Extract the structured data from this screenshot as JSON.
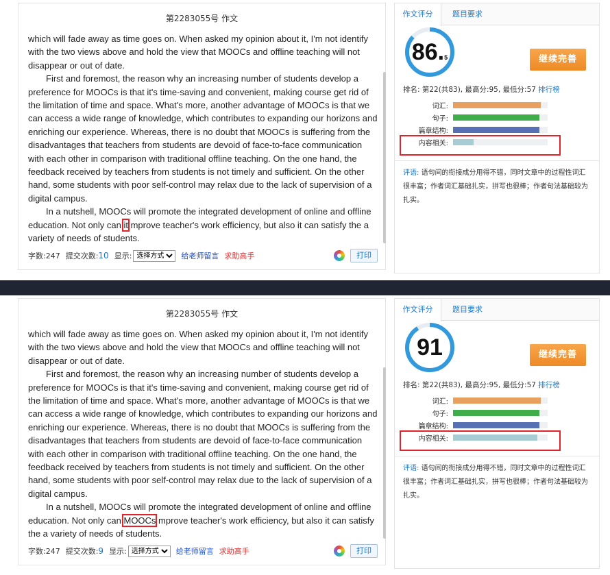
{
  "panels": [
    {
      "essay": {
        "title": "第2283055号 作文",
        "paragraphs": [
          {
            "indent": false,
            "text": "which will fade away as time goes on. When asked my opinion about it, I'm not identify with the two views above and hold the view that MOOCs and offline teaching will not disappear or out of date."
          },
          {
            "indent": true,
            "text": "First and foremost, the reason why an increasing number of students develop a preference for MOOCs is that it's time-saving and convenient, making course get rid of the limitation of time and space. What's more, another advantage of MOOCs is that we can access a wide range of knowledge, which contributes to expanding our horizons and enriching our experience. Whereas, there is no doubt that MOOCs is suffering from the disadvantages that teachers from students are devoid of face-to-face communication with each other in comparison with traditional offline teaching. On the one hand, the feedback received by teachers from students is not timely and sufficient. On the other hand, some students with poor self-control may relax due to the lack of supervision of a digital campus."
          },
          {
            "indent": true,
            "before": "In a nutshell, MOOCs will promote the integrated development of online and offline education. Not only can ",
            "highlight": "it",
            "after": " mprove teacher's work efficiency, but also it can satisfy the a variety of needs of students."
          }
        ]
      },
      "toolbar": {
        "word_count_label": "字数:247",
        "submit_label": "提交次数:",
        "submit_count": "10",
        "display_label": "显示:",
        "select_value": "选择方式",
        "teacher_link": "给老师留言",
        "help_link": "求助高手",
        "print_label": "打印"
      },
      "side": {
        "tab_score": "作文评分",
        "tab_requirement": "题目要求",
        "score_int": "86.",
        "score_dec": "5",
        "score_fraction": 0.865,
        "improve_label": "继续完善",
        "rank_text": "排名: 第22(共83), 最高分:95, 最低分:57",
        "rank_link": "排行榜",
        "metrics": [
          {
            "label": "词汇:",
            "fraction": 0.93,
            "color": "#e8a060"
          },
          {
            "label": "句子:",
            "fraction": 0.91,
            "color": "#3fae4a"
          },
          {
            "label": "篇章结构:",
            "fraction": 0.91,
            "color": "#5670b3"
          },
          {
            "label": "内容相关:",
            "fraction": 0.22,
            "color": "#a7ccd4"
          }
        ],
        "comment_key": "评语:",
        "comment_text": "语句间的衔接成分用得不错，同时文章中的过程性词汇很丰富；作者词汇基础扎实，拼写也很棒；作者句法基础较为扎实。"
      }
    },
    {
      "essay": {
        "title": "第2283055号 作文",
        "paragraphs": [
          {
            "indent": false,
            "text": "which will fade away as time goes on. When asked my opinion about it, I'm not identify with the two views above and hold the view that MOOCs and offline teaching will not disappear or out of date."
          },
          {
            "indent": true,
            "text": "First and foremost, the reason why an increasing number of students develop a preference for MOOCs is that it's time-saving and convenient, making course get rid of the limitation of time and space. What's more, another advantage of MOOCs is that we can access a wide range of knowledge, which contributes to expanding our horizons and enriching our experience. Whereas, there is no doubt that MOOCs is suffering from the disadvantages that teachers from students are devoid of face-to-face communication with each other in comparison with traditional offline teaching. On the one hand, the feedback received by teachers from students is not timely and sufficient. On the other hand, some students with poor self-control may relax due to the lack of supervision of a digital campus."
          },
          {
            "indent": true,
            "before": "In a nutshell, MOOCs will promote the integrated development of online and offline education. Not only can ",
            "highlight": "MOOCs",
            "after": " mprove teacher's work efficiency, but also it can satisfy the a variety of needs of students."
          }
        ]
      },
      "toolbar": {
        "word_count_label": "字数:247",
        "submit_label": "提交次数:",
        "submit_count": "9",
        "display_label": "显示:",
        "select_value": "选择方式",
        "teacher_link": "给老师留言",
        "help_link": "求助高手",
        "print_label": "打印"
      },
      "side": {
        "tab_score": "作文评分",
        "tab_requirement": "题目要求",
        "score_int": "91",
        "score_dec": "",
        "score_fraction": 0.91,
        "improve_label": "继续完善",
        "rank_text": "排名: 第22(共83), 最高分:95, 最低分:57",
        "rank_link": "排行榜",
        "metrics": [
          {
            "label": "词汇:",
            "fraction": 0.93,
            "color": "#e8a060"
          },
          {
            "label": "句子:",
            "fraction": 0.91,
            "color": "#3fae4a"
          },
          {
            "label": "篇章结构:",
            "fraction": 0.91,
            "color": "#5670b3"
          },
          {
            "label": "内容相关:",
            "fraction": 0.89,
            "color": "#a7ccd4"
          }
        ],
        "comment_key": "评语:",
        "comment_text": "语句间的衔接成分用得不错，同时文章中的过程性词汇很丰富；作者词汇基础扎实，拼写也很棒；作者句法基础较为扎实。"
      }
    }
  ]
}
